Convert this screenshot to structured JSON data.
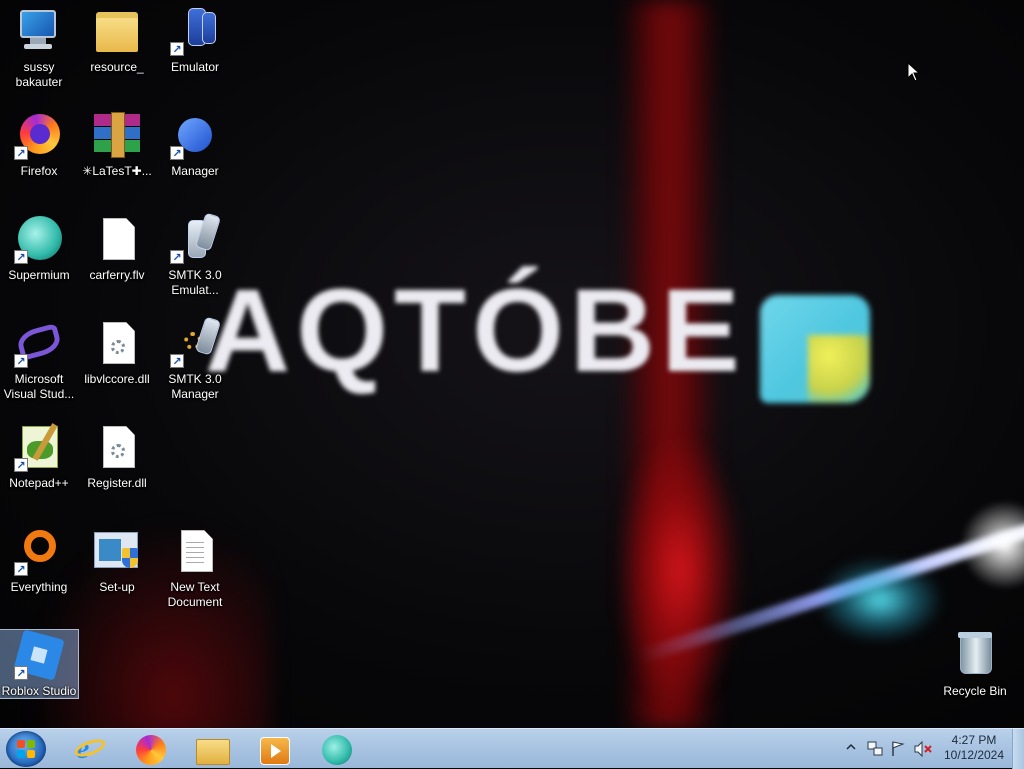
{
  "desktop": {
    "wallpaper_text": "AQTÓBE",
    "icons": [
      {
        "label": "sussy bakauter",
        "icon": "computer-icon"
      },
      {
        "label": "resource_",
        "icon": "folder-icon"
      },
      {
        "label": "Emulator",
        "icon": "emulator-icon"
      },
      {
        "label": "Firefox",
        "icon": "firefox-icon"
      },
      {
        "label": "✳LaTesT✚...",
        "icon": "winrar-icon"
      },
      {
        "label": "Manager",
        "icon": "manager-icon"
      },
      {
        "label": "Supermium",
        "icon": "supermium-icon"
      },
      {
        "label": "carferry.flv",
        "icon": "file-icon"
      },
      {
        "label": "SMTK 3.0 Emulat...",
        "icon": "smtk-emulator-icon"
      },
      {
        "label": "Microsoft Visual Stud...",
        "icon": "visual-studio-icon"
      },
      {
        "label": "libvlccore.dll",
        "icon": "dll-file-icon"
      },
      {
        "label": "SMTK 3.0 Manager",
        "icon": "smtk-manager-icon"
      },
      {
        "label": "Notepad++",
        "icon": "notepadpp-icon"
      },
      {
        "label": "Register.dll",
        "icon": "dll-file-icon"
      },
      {
        "label": "Everything",
        "icon": "everything-icon"
      },
      {
        "label": "Set-up",
        "icon": "setup-icon"
      },
      {
        "label": "New Text Document",
        "icon": "text-document-icon"
      },
      {
        "label": "Roblox Studio",
        "icon": "roblox-studio-icon"
      },
      {
        "label": "Recycle Bin",
        "icon": "recycle-bin-icon"
      }
    ]
  },
  "taskbar": {
    "start_icon": "windows-start-icon",
    "pinned": [
      {
        "icon": "internet-explorer-icon"
      },
      {
        "icon": "firefox-icon"
      },
      {
        "icon": "file-explorer-icon"
      },
      {
        "icon": "media-player-icon"
      },
      {
        "icon": "supermium-icon"
      }
    ],
    "tray": {
      "icons": [
        "show-hidden-icons-arrow",
        "network-icon",
        "action-center-flag-icon",
        "volume-muted-icon"
      ],
      "time": "4:27 PM",
      "date": "10/12/2024"
    }
  },
  "colors": {
    "taskbar_top": "#b9d1ea",
    "taskbar_bottom": "#9ab8da",
    "selection": "#a0c8ff",
    "logo_cyan": "#4fc7e0",
    "logo_yellow": "#f0f05a"
  }
}
